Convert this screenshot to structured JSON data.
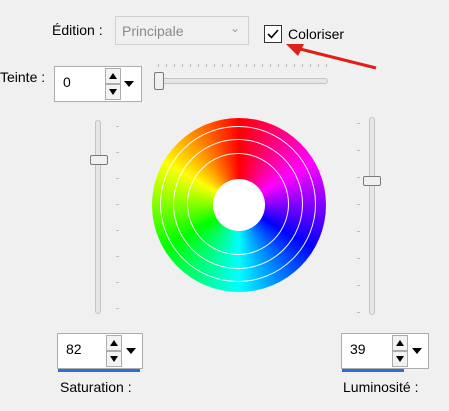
{
  "edition": {
    "label": "Édition :",
    "selected": "Principale"
  },
  "colorize": {
    "label": "Coloriser",
    "checked": true
  },
  "hue": {
    "label": "Teinte :",
    "value": "0",
    "slider_level_percent": 3
  },
  "saturation": {
    "label": "Saturation :",
    "value": "82",
    "slider_level_percent": 74
  },
  "luminosity": {
    "label": "Luminosité :",
    "value": "39",
    "slider_level_percent": 69
  },
  "icons": [
    "checkmark-icon",
    "spin-up-icon",
    "spin-down-icon",
    "dropdown-arrow-icon",
    "red-arrow-annotation"
  ],
  "colors": {
    "accent": "#2b6fd6",
    "annotation": "#e0201a"
  }
}
